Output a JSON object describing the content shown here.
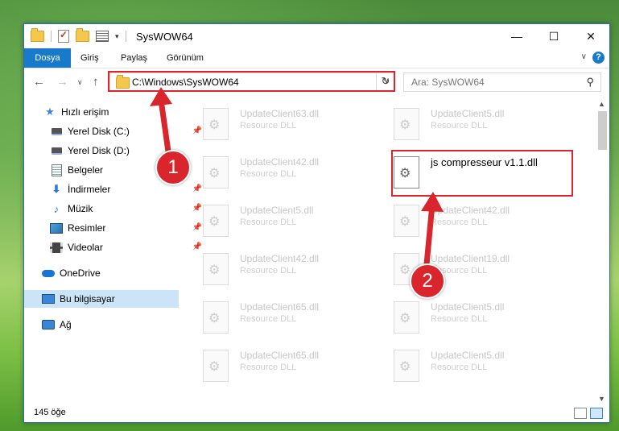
{
  "window": {
    "title": "SysWOW64",
    "controls": {
      "minimize": "—",
      "maximize": "☐",
      "close": "✕"
    }
  },
  "ribbon": {
    "tabs": [
      "Dosya",
      "Giriş",
      "Paylaş",
      "Görünüm"
    ],
    "help": "?"
  },
  "nav": {
    "address": "C:\\Windows\\SysWOW64",
    "search_placeholder": "Ara: SysWOW64"
  },
  "sidebar": {
    "items": [
      {
        "label": "Hızlı erişim",
        "icon": "star-icon"
      },
      {
        "label": "Yerel Disk (C:)",
        "icon": "drive-icon"
      },
      {
        "label": "Yerel Disk (D:)",
        "icon": "drive-icon"
      },
      {
        "label": "Belgeler",
        "icon": "documents-icon"
      },
      {
        "label": "İndirmeler",
        "icon": "downloads-icon"
      },
      {
        "label": "Müzik",
        "icon": "music-icon"
      },
      {
        "label": "Resimler",
        "icon": "pictures-icon"
      },
      {
        "label": "Videolar",
        "icon": "videos-icon"
      },
      {
        "label": "OneDrive",
        "icon": "onedrive-icon"
      },
      {
        "label": "Bu bilgisayar",
        "icon": "computer-icon"
      },
      {
        "label": "Ağ",
        "icon": "network-icon"
      }
    ]
  },
  "files": [
    {
      "name": "UpdateClient63.dll",
      "type": "Resource DLL"
    },
    {
      "name": "UpdateClient5.dll",
      "type": "Resource DLL"
    },
    {
      "name": "UpdateClient42.dll",
      "type": "Resource DLL"
    },
    {
      "name": "js compresseur v1.1.dll",
      "type": ""
    },
    {
      "name": "UpdateClient5.dll",
      "type": "Resource DLL"
    },
    {
      "name": "UpdateClient42.dll",
      "type": "Resource DLL"
    },
    {
      "name": "UpdateClient42.dll",
      "type": "Resource DLL"
    },
    {
      "name": "UpdateClient19.dll",
      "type": "Resource DLL"
    },
    {
      "name": "UpdateClient65.dll",
      "type": "Resource DLL"
    },
    {
      "name": "UpdateClient5.dll",
      "type": "Resource DLL"
    },
    {
      "name": "UpdateClient65.dll",
      "type": "Resource DLL"
    },
    {
      "name": "UpdateClient5.dll",
      "type": "Resource DLL"
    }
  ],
  "status": {
    "count": "145 öğe"
  },
  "annotations": {
    "step1": "1",
    "step2": "2",
    "color": "#d8262c"
  }
}
